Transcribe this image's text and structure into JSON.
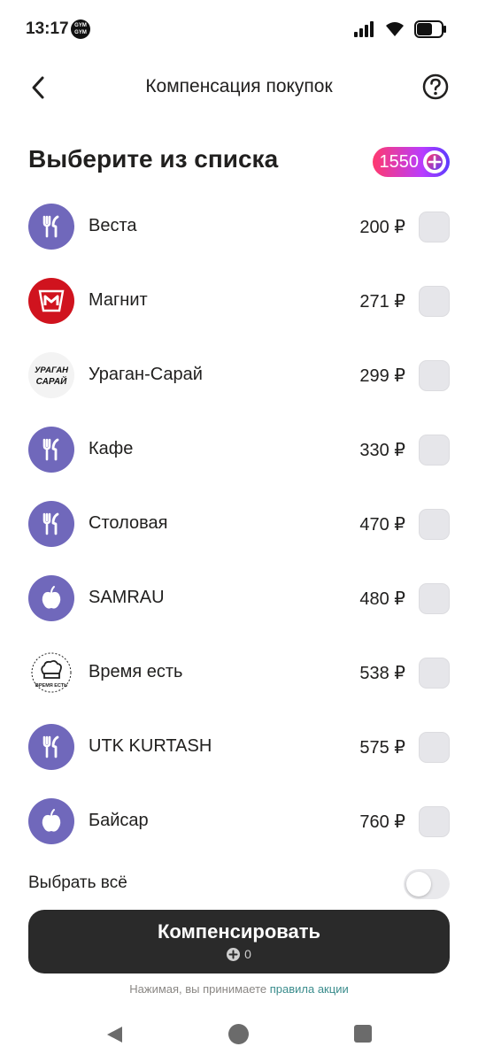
{
  "status": {
    "time": "13:17",
    "badge_text": "GYM GYM"
  },
  "header": {
    "title": "Компенсация покупок"
  },
  "section": {
    "title": "Выберите из списка",
    "points": "1550"
  },
  "items": [
    {
      "name": "Веста",
      "price": "200 ₽",
      "logo": "fork-knife-icon"
    },
    {
      "name": "Магнит",
      "price": "271 ₽",
      "logo": "magnit-logo"
    },
    {
      "name": "Ураган-Сарай",
      "price": "299 ₽",
      "logo": "uragan-sarai-logo",
      "logo_text_1": "УРАГАН",
      "logo_text_2": "САРАЙ"
    },
    {
      "name": "Кафе",
      "price": "330 ₽",
      "logo": "fork-knife-icon"
    },
    {
      "name": "Столовая",
      "price": "470 ₽",
      "logo": "fork-knife-icon"
    },
    {
      "name": "SAMRAU",
      "price": "480 ₽",
      "logo": "apple-icon"
    },
    {
      "name": "Время есть",
      "price": "538 ₽",
      "logo": "chef-hat-logo",
      "logo_text_1": "ВРЕМЯ ЕСТЬ"
    },
    {
      "name": "UTK KURTASH",
      "price": "575 ₽",
      "logo": "fork-knife-icon"
    },
    {
      "name": "Байсар",
      "price": "760 ₽",
      "logo": "apple-icon"
    }
  ],
  "select_all": {
    "label": "Выбрать всё",
    "checked": false
  },
  "cta": {
    "label": "Компенсировать",
    "points": "0"
  },
  "terms": {
    "text": "Нажимая, вы принимаете ",
    "link": "правила акции"
  },
  "colors": {
    "accent_purple": "#7068bb",
    "magnit_red": "#d0131e",
    "button_dark": "#2a2a2a",
    "link_teal": "#3a8c8c"
  }
}
